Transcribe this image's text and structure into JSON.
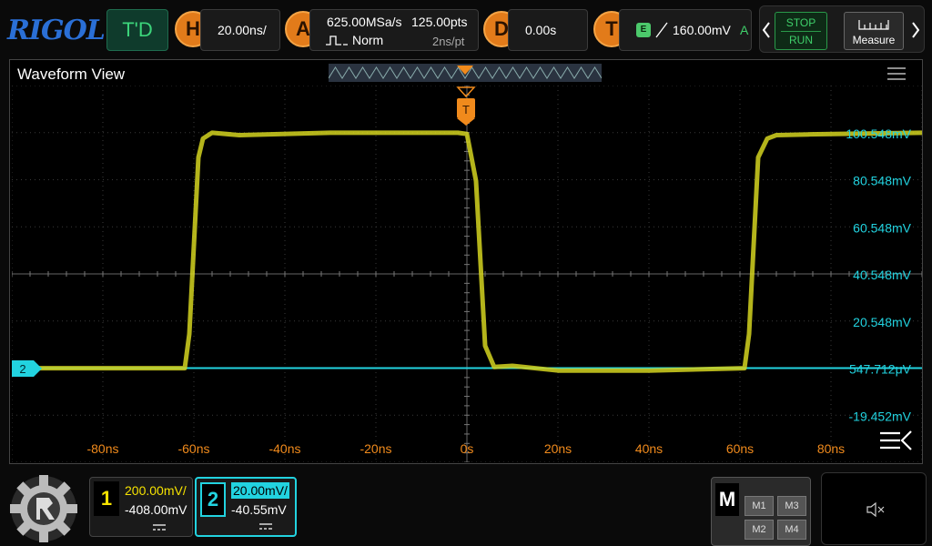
{
  "brand": "RIGOL",
  "mode": "T'D",
  "horizontal": {
    "letter": "H",
    "scale": "20.00ns/"
  },
  "acquire": {
    "letter": "A",
    "sample_rate": "625.00MSa/s",
    "points": "125.00pts",
    "mode": "Norm",
    "interval": "2ns/pt"
  },
  "delay": {
    "letter": "D",
    "value": "0.00s"
  },
  "trigger": {
    "letter": "T",
    "source_badge": "E",
    "level": "160.00mV",
    "status": "A"
  },
  "controls": {
    "stop_label": "STOP",
    "run_label": "RUN",
    "measure_label": "Measure"
  },
  "window": {
    "title": "Waveform View"
  },
  "trigger_marker": "T",
  "channel2_marker": "2",
  "chart_data": {
    "type": "line",
    "x_unit": "ns",
    "x_ticks": [
      "-80ns",
      "-60ns",
      "-40ns",
      "-20ns",
      "0s",
      "20ns",
      "40ns",
      "60ns",
      "80ns"
    ],
    "x_tick_values": [
      -80,
      -60,
      -40,
      -20,
      0,
      20,
      40,
      60,
      80
    ],
    "y_ticks": [
      "100.548mV",
      "80.548mV",
      "60.548mV",
      "40.548mV",
      "20.548mV",
      "547.712μV",
      "-19.452mV"
    ],
    "y_tick_values_mV": [
      100.548,
      80.548,
      60.548,
      40.548,
      20.548,
      0.548,
      -19.452
    ],
    "xlim": [
      -100,
      100
    ],
    "ylim": [
      -39.452,
      120.548
    ],
    "grid": true,
    "series": [
      {
        "channel": "1",
        "color": "#d4d420",
        "x": [
          -100,
          -62,
          -61,
          -59,
          -58,
          -56,
          -50,
          -30,
          -2,
          0,
          2,
          4,
          6,
          10,
          20,
          40,
          61,
          62,
          64,
          66,
          68,
          75,
          100
        ],
        "y": [
          0.5,
          0.5,
          15,
          90,
          98,
          100.5,
          99.5,
          100.5,
          100.5,
          100,
          80,
          10,
          1,
          1.5,
          -0.5,
          -0.5,
          0.5,
          15,
          90,
          98,
          99.5,
          99.8,
          100.5
        ]
      },
      {
        "channel": "2",
        "color": "#22d3e0",
        "x": [
          -100,
          100
        ],
        "y": [
          0.55,
          0.55
        ]
      }
    ]
  },
  "ch1": {
    "number": "1",
    "scale": "200.00mV/",
    "offset": "-408.00mV",
    "coupling": "DC"
  },
  "ch2": {
    "number": "2",
    "scale": "20.00mV/",
    "offset": "-40.55mV",
    "coupling": "DC"
  },
  "math": {
    "label": "M",
    "m1": "M1",
    "m2": "M2",
    "m3": "M3",
    "m4": "M4"
  },
  "colors": {
    "ch1": "#f5e200",
    "ch2": "#22d3e0",
    "trigger": "#f08a1c",
    "label": "#f08a1c"
  }
}
